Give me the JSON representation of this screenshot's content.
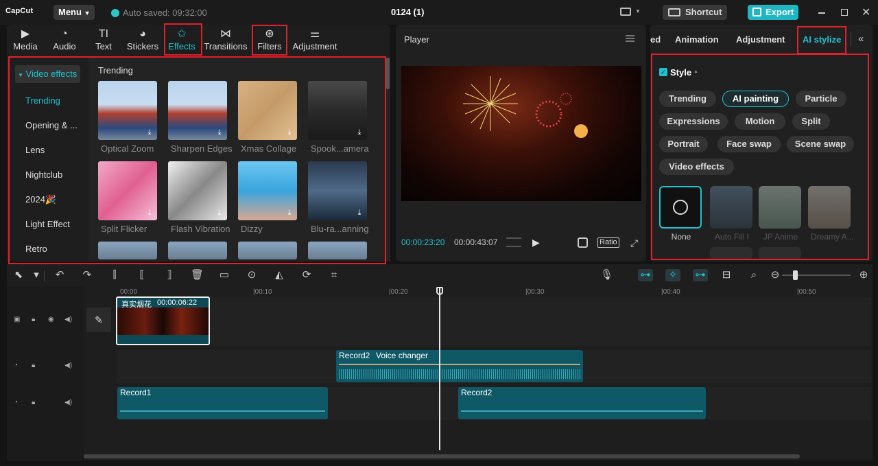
{
  "app": {
    "logo": "CapCut",
    "menu_label": "Menu",
    "autosave": "Auto saved: 09:32:00",
    "project_title": "0124 (1)",
    "shortcut_label": "Shortcut",
    "export_label": "Export"
  },
  "left_tabs": [
    {
      "label": "Media",
      "icon": "media-icon",
      "glyph": "▶"
    },
    {
      "label": "Audio",
      "icon": "audio-icon",
      "glyph": "◔"
    },
    {
      "label": "Text",
      "icon": "text-icon",
      "glyph": "TI"
    },
    {
      "label": "Stickers",
      "icon": "sticker-icon",
      "glyph": "◕"
    },
    {
      "label": "Effects",
      "icon": "effects-icon",
      "glyph": "✩"
    },
    {
      "label": "Transitions",
      "icon": "transitions-icon",
      "glyph": "⋈"
    },
    {
      "label": "Filters",
      "icon": "filters-icon",
      "glyph": "⊛"
    },
    {
      "label": "Adjustment",
      "icon": "adjustment-icon",
      "glyph": "⚌"
    }
  ],
  "sidebar": {
    "header": "Video effects",
    "items": [
      "Trending",
      "Opening & ...",
      "Lens",
      "Nightclub",
      "2024🎉",
      "Light Effect",
      "Retro"
    ]
  },
  "effects": {
    "section": "Trending",
    "items": [
      "Optical Zoom",
      "Sharpen Edges",
      "Xmas Collage",
      "Spook...amera",
      "Split Flicker",
      "Flash Vibration",
      "Dizzy",
      "Blu-ra...anning"
    ]
  },
  "player": {
    "title": "Player",
    "current_time": "00:00:23:20",
    "total_time": "00:00:43:07",
    "ratio_label": "Ratio"
  },
  "right_tabs": [
    "ed",
    "Animation",
    "Adjustment",
    "AI stylize"
  ],
  "style": {
    "title": "Style",
    "buttons": [
      "Trending",
      "AI painting",
      "Particle",
      "Expressions",
      "Motion",
      "Split",
      "Portrait",
      "Face swap",
      "Scene swap",
      "Video effects"
    ],
    "selected": "AI painting",
    "presets": [
      "None",
      "Auto Fill I",
      "JP Anime",
      "Dreamy A..."
    ]
  },
  "timeline": {
    "ticks": [
      "00:00",
      "|00:10",
      "|00:20",
      "|00:30",
      "|00:40",
      "|00:50"
    ],
    "video_clip": {
      "name": "真实烟花",
      "duration": "00:00:06:22"
    },
    "audio_clip1": {
      "name": "Record2",
      "tag": "Voice changer"
    },
    "audio_clip2": {
      "name": "Record1"
    },
    "audio_clip3": {
      "name": "Record2"
    }
  },
  "colors": {
    "accent": "#1fc2d0",
    "highlight_box": "#e0212b",
    "clip_teal": "#1a5a66"
  }
}
